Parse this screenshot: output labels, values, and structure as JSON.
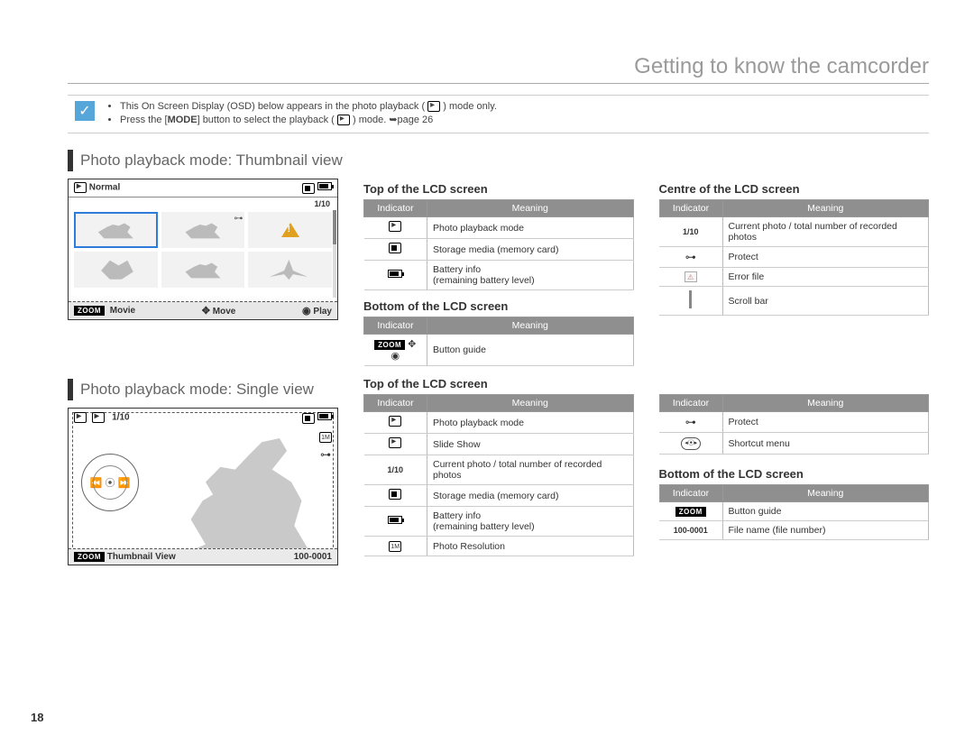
{
  "page_number": "18",
  "chapter_title": "Getting to know the camcorder",
  "info_notes": {
    "line1_pre": "This On Screen Display (OSD) below appears in the photo playback (",
    "line1_post": " ) mode only.",
    "line2_pre": "Press the [",
    "line2_mode": "MODE",
    "line2_mid": "] button to select the playback (",
    "line2_post": ") mode. ➥page 26"
  },
  "section1_title": "Photo playback mode: Thumbnail view",
  "section2_title": "Photo playback mode: Single view",
  "lcd_thumb": {
    "top_left_label": "Normal",
    "counter": "1/10",
    "bottom_zoom": "ZOOM",
    "bottom_movie": "Movie",
    "bottom_move": "Move",
    "bottom_play": "Play"
  },
  "lcd_single": {
    "counter": "1/10",
    "bottom_zoom": "ZOOM",
    "bottom_left": "Thumbnail View",
    "bottom_right": "100-0001"
  },
  "table_headers": {
    "indicator": "Indicator",
    "meaning": "Meaning"
  },
  "thumb_top_h": "Top of the LCD screen",
  "thumb_bottom_h": "Bottom of the LCD screen",
  "thumb_centre_h": "Centre of the LCD screen",
  "thumb_top": [
    {
      "icon": "photo-mode",
      "meaning": "Photo playback mode"
    },
    {
      "icon": "card",
      "meaning": "Storage media (memory card)"
    },
    {
      "icon": "battery",
      "meaning": "Battery info\n(remaining battery level)"
    }
  ],
  "thumb_bottom": [
    {
      "icon": "zoom-guide",
      "meaning": "Button guide"
    }
  ],
  "thumb_centre": [
    {
      "icon": "1/10",
      "meaning": "Current photo / total number of recorded photos"
    },
    {
      "icon": "protect",
      "meaning": "Protect"
    },
    {
      "icon": "error",
      "meaning": "Error file"
    },
    {
      "icon": "scrollbar",
      "meaning": "Scroll bar"
    }
  ],
  "single_top_h": "Top of the LCD screen",
  "single_top_left": [
    {
      "icon": "photo-mode",
      "meaning": "Photo playback mode"
    },
    {
      "icon": "slideshow",
      "meaning": "Slide Show"
    },
    {
      "icon": "1/10",
      "meaning": "Current photo / total number of recorded photos"
    },
    {
      "icon": "card",
      "meaning": "Storage media (memory card)"
    },
    {
      "icon": "battery",
      "meaning": "Battery info\n(remaining battery level)"
    },
    {
      "icon": "resolution",
      "meaning": "Photo Resolution"
    }
  ],
  "single_top_right": [
    {
      "icon": "protect",
      "meaning": "Protect"
    },
    {
      "icon": "dial",
      "meaning": "Shortcut menu"
    }
  ],
  "single_bottom_h": "Bottom of the LCD screen",
  "single_bottom": [
    {
      "icon": "zoom",
      "meaning": "Button guide"
    },
    {
      "icon": "100-0001",
      "meaning": "File name (file number)"
    }
  ]
}
